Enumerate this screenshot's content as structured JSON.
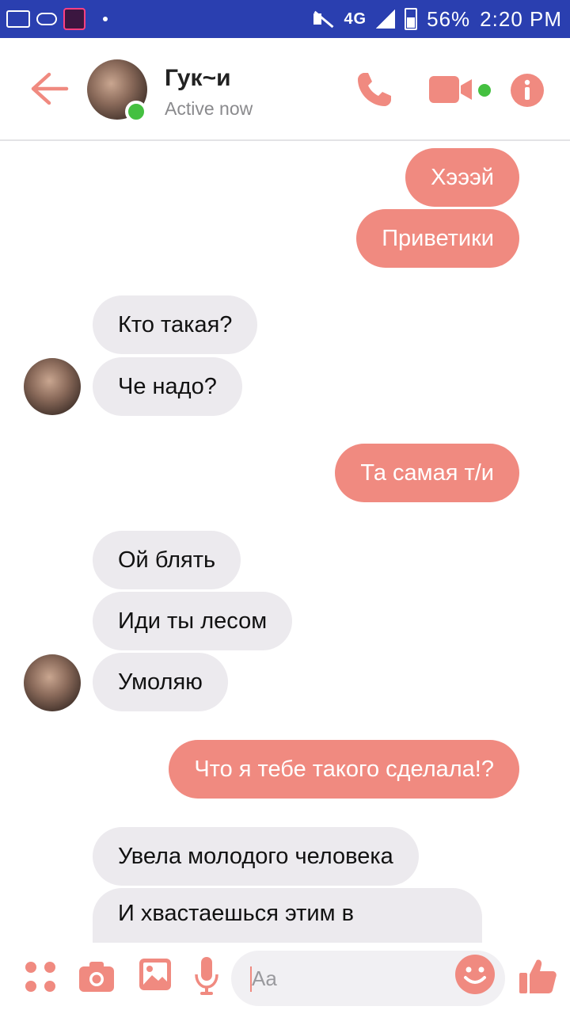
{
  "status_bar": {
    "network": "4G",
    "battery": "56%",
    "time": "2:20 PM"
  },
  "header": {
    "contact_name": "Гук~и",
    "contact_status": "Active now"
  },
  "messages": [
    {
      "direction": "out",
      "text": "Хэээй"
    },
    {
      "direction": "out",
      "text": "Приветики"
    },
    {
      "direction": "in",
      "text": "Кто такая?"
    },
    {
      "direction": "in",
      "text": "Че надо?"
    },
    {
      "direction": "out",
      "text": "Та самая т/и"
    },
    {
      "direction": "in",
      "text": "Ой блять"
    },
    {
      "direction": "in",
      "text": "Иди ты лесом"
    },
    {
      "direction": "in",
      "text": "Умоляю"
    },
    {
      "direction": "out",
      "text": "Что я тебе такого сделала!?"
    },
    {
      "direction": "in",
      "text": "Увела молодого человека"
    },
    {
      "direction": "in",
      "text": "И хвастаешься этим в"
    }
  ],
  "composer": {
    "placeholder": "Aa"
  },
  "colors": {
    "accent": "#f08a80",
    "incoming_bubble": "#eceaee",
    "online": "#44c040",
    "status_bar": "#2a3fb0"
  }
}
